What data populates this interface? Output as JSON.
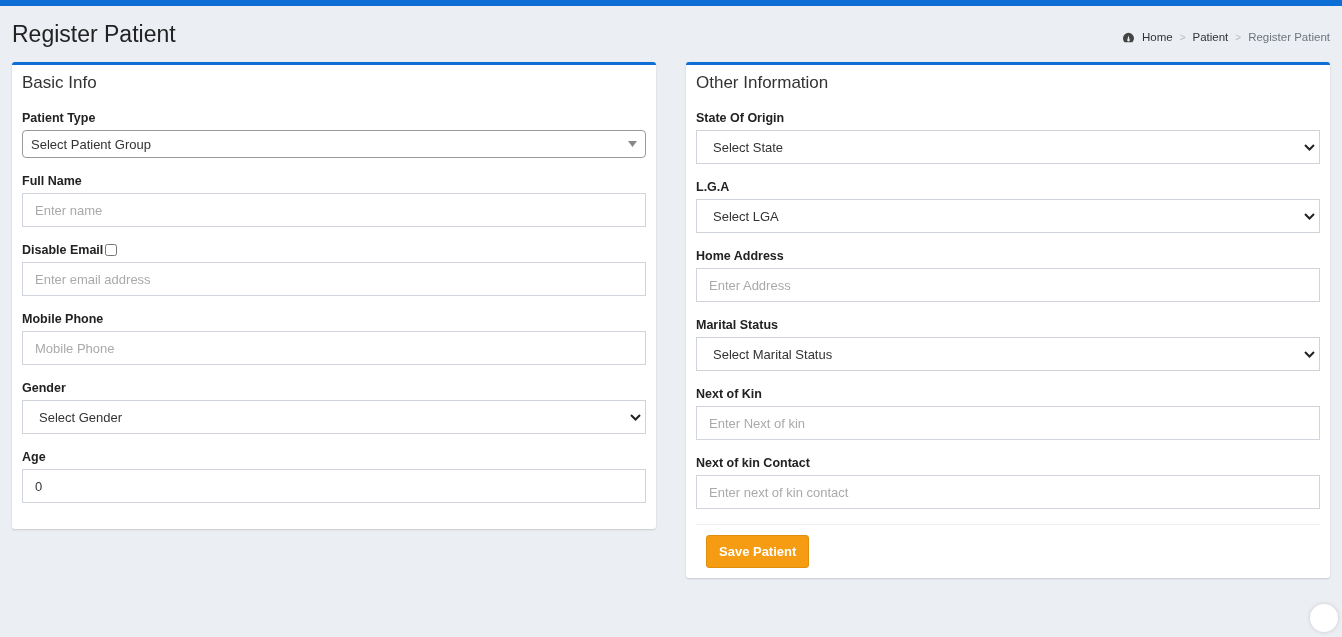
{
  "page_title": "Register Patient",
  "breadcrumb": [
    {
      "label": "Home",
      "kind": "home"
    },
    {
      "label": "Patient",
      "kind": "link"
    },
    {
      "label": "Register Patient",
      "kind": "current"
    }
  ],
  "breadcrumb_separator": ">",
  "cards": [
    {
      "title": "Basic Info",
      "fields": [
        {
          "label": "Patient Type",
          "kind": "combo",
          "value": "Select Patient Group"
        },
        {
          "label": "Full Name",
          "kind": "text",
          "placeholder": "Enter name"
        },
        {
          "label": "Disable Email",
          "kind": "text",
          "placeholder": "Enter email address",
          "checkbox": {
            "checked": false
          }
        },
        {
          "label": "Mobile Phone",
          "kind": "text",
          "placeholder": "Mobile Phone"
        },
        {
          "label": "Gender",
          "kind": "select",
          "value": "Select Gender"
        },
        {
          "label": "Age",
          "kind": "text",
          "value": "0"
        }
      ]
    },
    {
      "title": "Other Information",
      "fields": [
        {
          "label": "State Of Origin",
          "kind": "select",
          "value": "Select State"
        },
        {
          "label": "L.G.A",
          "kind": "select",
          "value": "Select LGA"
        },
        {
          "label": "Home Address",
          "kind": "text",
          "placeholder": "Enter Address"
        },
        {
          "label": "Marital Status",
          "kind": "select",
          "value": "Select Marital Status"
        },
        {
          "label": "Next of Kin",
          "kind": "text",
          "placeholder": "Enter Next of kin"
        },
        {
          "label": "Next of kin Contact",
          "kind": "text",
          "placeholder": "Enter next of kin contact"
        }
      ],
      "button": "Save Patient"
    }
  ]
}
